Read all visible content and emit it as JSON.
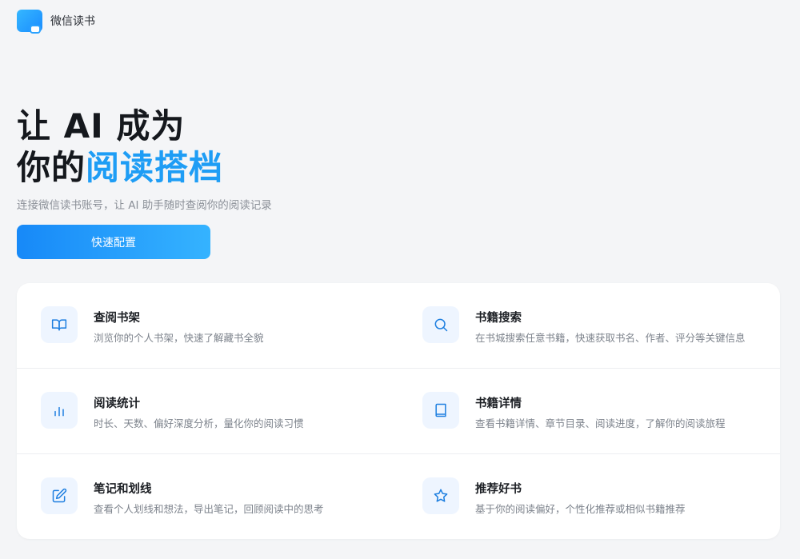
{
  "brand": {
    "name": "微信读书"
  },
  "hero": {
    "title_line1": "让 AI 成为",
    "title_line2_prefix": "你的",
    "title_line2_accent": "阅读搭档",
    "subtitle": "连接微信读书账号，让 AI 助手随时查阅你的阅读记录",
    "cta_label": "快速配置"
  },
  "colors": {
    "accent": "#1e9df5",
    "cta_gradient_start": "#1789f8",
    "cta_gradient_end": "#35b3ff",
    "icon_bg": "#eef5ff",
    "icon_stroke": "#1e7fe0"
  },
  "features": [
    {
      "icon": "book-open-icon",
      "title": "查阅书架",
      "desc": "浏览你的个人书架，快速了解藏书全貌"
    },
    {
      "icon": "search-icon",
      "title": "书籍搜索",
      "desc": "在书城搜索任意书籍，快速获取书名、作者、评分等关键信息"
    },
    {
      "icon": "bar-chart-icon",
      "title": "阅读统计",
      "desc": "时长、天数、偏好深度分析，量化你的阅读习惯"
    },
    {
      "icon": "book-icon",
      "title": "书籍详情",
      "desc": "查看书籍详情、章节目录、阅读进度，了解你的阅读旅程"
    },
    {
      "icon": "edit-icon",
      "title": "笔记和划线",
      "desc": "查看个人划线和想法，导出笔记，回顾阅读中的思考"
    },
    {
      "icon": "star-icon",
      "title": "推荐好书",
      "desc": "基于你的阅读偏好，个性化推荐或相似书籍推荐"
    }
  ]
}
